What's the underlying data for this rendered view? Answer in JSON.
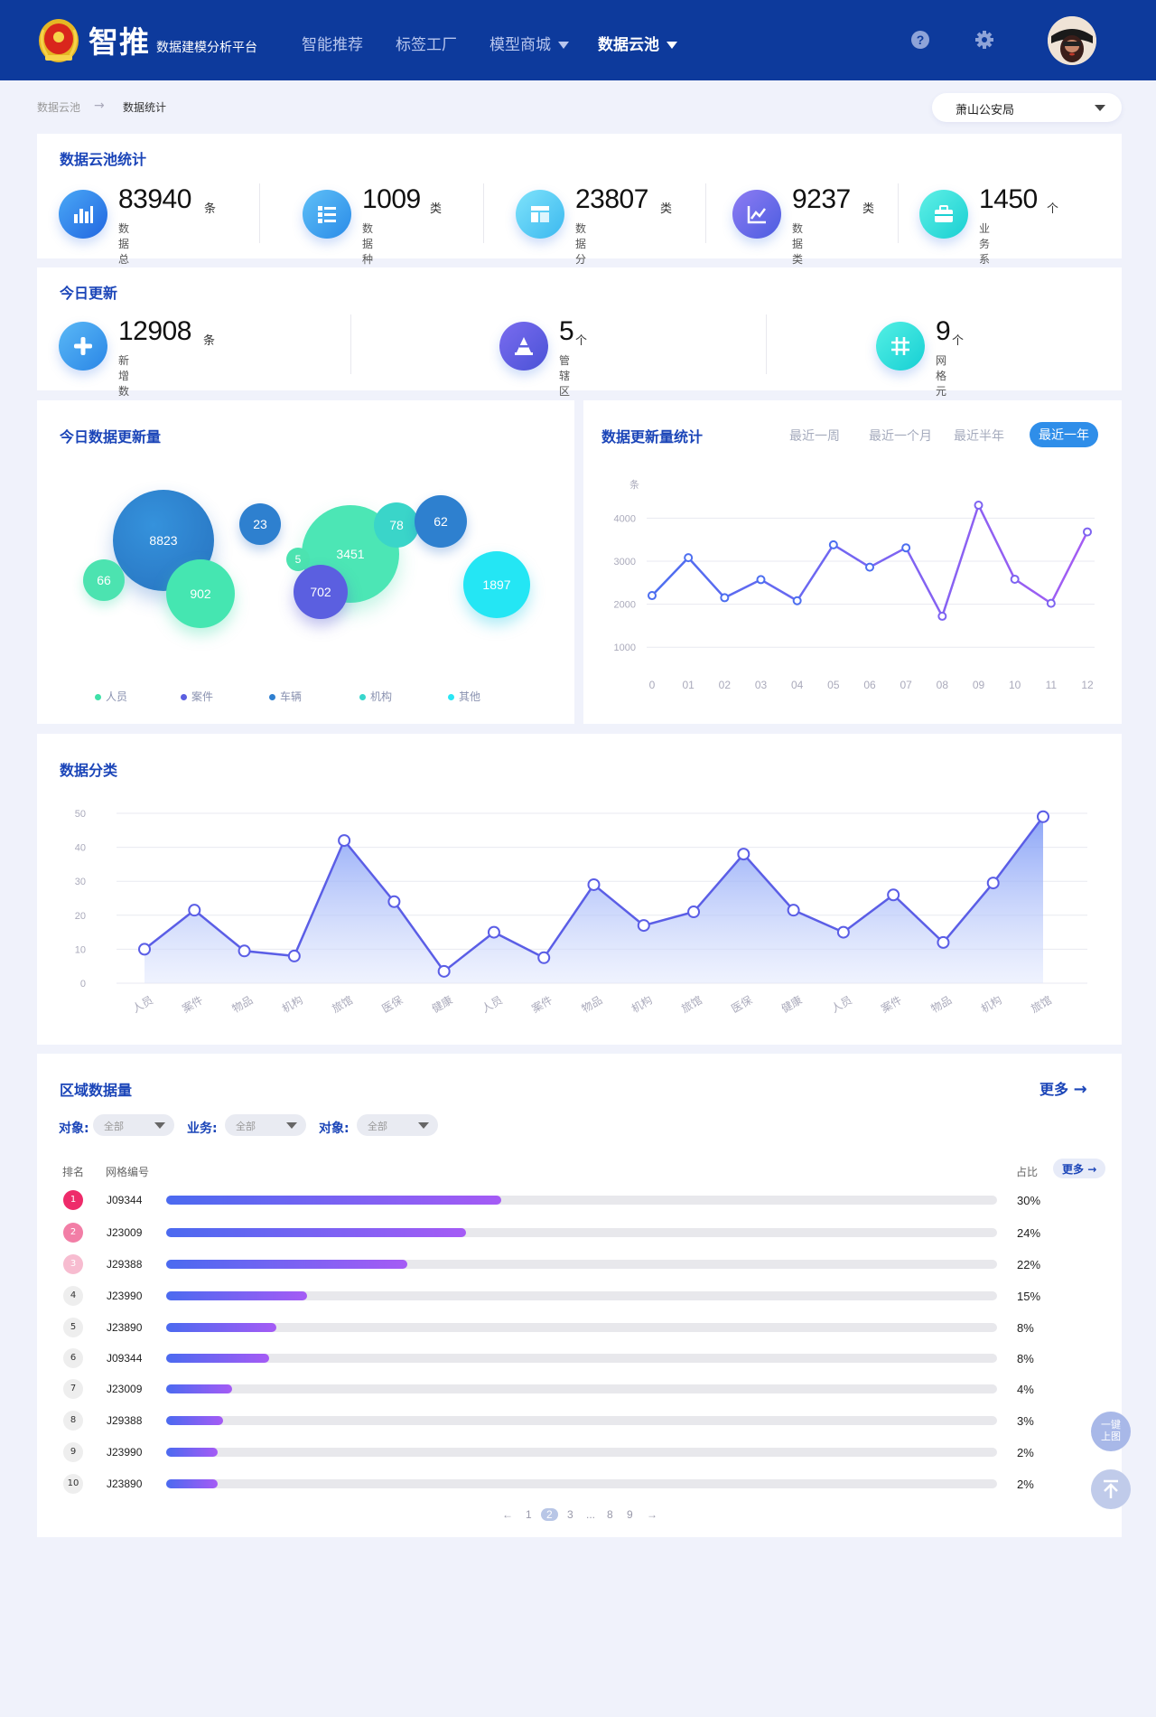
{
  "header": {
    "brand": "智推",
    "brand_sub": "数据建模分析平台",
    "nav": [
      {
        "label": "智能推荐"
      },
      {
        "label": "标签工厂"
      },
      {
        "label": "模型商城"
      },
      {
        "label": "数据云池"
      }
    ]
  },
  "breadcrumb": {
    "root": "数据云池",
    "current": "数据统计"
  },
  "org_select": {
    "value": "萧山公安局"
  },
  "cloud_stats": {
    "title": "数据云池统计",
    "items": [
      {
        "value": "83940",
        "unit": "条",
        "label": "数据总量",
        "icon": "bar-chart-icon",
        "color": "#2f7fea"
      },
      {
        "value": "1009",
        "unit": "类",
        "label": "数据种类",
        "icon": "list-icon",
        "color": "#3a9ef0"
      },
      {
        "value": "23807",
        "unit": "类",
        "label": "数据分类",
        "icon": "table-icon",
        "color": "#5fd2f5"
      },
      {
        "value": "9237",
        "unit": "类",
        "label": "数据类别",
        "icon": "trend-icon",
        "color": "#6a66e8"
      },
      {
        "value": "1450",
        "unit": "个",
        "label": "业务系统",
        "icon": "briefcase-icon",
        "color": "#26d9d9"
      }
    ]
  },
  "today": {
    "title": "今日更新",
    "items": [
      {
        "value": "12908",
        "unit": "条",
        "label": "新增数据量",
        "icon": "plus-icon",
        "color": "#2f9ff0"
      },
      {
        "value": "5",
        "unit": "个",
        "label": "管辖区",
        "icon": "cone-icon",
        "color": "#5a5fe0"
      },
      {
        "value": "9",
        "unit": "个",
        "label": "网格元",
        "icon": "grid-icon",
        "color": "#27dbd9"
      }
    ]
  },
  "bubbles": {
    "title": "今日数据更新量",
    "items": [
      {
        "value": "8823",
        "category": "车辆"
      },
      {
        "value": "23",
        "category": "车辆"
      },
      {
        "value": "66",
        "category": "人员"
      },
      {
        "value": "902",
        "category": "人员"
      },
      {
        "value": "3451",
        "category": "人员"
      },
      {
        "value": "78",
        "category": "机构"
      },
      {
        "value": "62",
        "category": "车辆"
      },
      {
        "value": "5",
        "category": "人员"
      },
      {
        "value": "702",
        "category": "案件"
      },
      {
        "value": "1897",
        "category": "其他"
      }
    ],
    "legend": [
      {
        "label": "人员",
        "color": "#3fe0a8"
      },
      {
        "label": "案件",
        "color": "#5b5fe0"
      },
      {
        "label": "车辆",
        "color": "#2f7fd0"
      },
      {
        "label": "机构",
        "color": "#38d6cc"
      },
      {
        "label": "其他",
        "color": "#2ae6f5"
      }
    ]
  },
  "update_chart": {
    "title": "数据更新量统计",
    "tabs": [
      "最近一周",
      "最近一个月",
      "最近半年",
      "最近一年"
    ],
    "active_tab": 3
  },
  "category_chart": {
    "title": "数据分类"
  },
  "chart_data": [
    {
      "type": "line",
      "ylabel": "条",
      "x": [
        "0",
        "01",
        "02",
        "03",
        "04",
        "05",
        "06",
        "07",
        "08",
        "09",
        "10",
        "11",
        "12"
      ],
      "values": [
        2200,
        3080,
        2150,
        2570,
        2080,
        3380,
        2860,
        3310,
        1720,
        4300,
        2580,
        2020,
        3680
      ],
      "yticks": [
        1000,
        2000,
        3000,
        4000
      ],
      "ylim": [
        500,
        4700
      ],
      "grid": true
    },
    {
      "type": "area",
      "categories": [
        "人员",
        "案件",
        "物品",
        "机构",
        "旅馆",
        "医保",
        "健康",
        "人员",
        "案件",
        "物品",
        "机构",
        "旅馆",
        "医保",
        "健康",
        "人员",
        "案件",
        "物品",
        "机构",
        "旅馆"
      ],
      "values": [
        10,
        21.5,
        9.5,
        8,
        42,
        24,
        3.5,
        15,
        7.5,
        29,
        17,
        21,
        38,
        21.5,
        15,
        26,
        12,
        29.5,
        49
      ],
      "yticks": [
        0,
        10,
        20,
        30,
        40,
        50
      ],
      "ylim": [
        0,
        50
      ],
      "grid": true
    }
  ],
  "region": {
    "title": "区域数据量",
    "more": "更多",
    "filters": [
      {
        "label": "对象:",
        "value": "全部"
      },
      {
        "label": "业务:",
        "value": "全部"
      },
      {
        "label": "对象:",
        "value": "全部"
      }
    ],
    "headers": {
      "rank": "排名",
      "code": "网格编号",
      "pct": "占比",
      "more": "更多"
    },
    "rows": [
      {
        "rank": "1",
        "code": "J09344",
        "pct": "30%",
        "ratio": 0.403
      },
      {
        "rank": "2",
        "code": "J23009",
        "pct": "24%",
        "ratio": 0.361
      },
      {
        "rank": "3",
        "code": "J29388",
        "pct": "22%",
        "ratio": 0.29
      },
      {
        "rank": "4",
        "code": "J23990",
        "pct": "15%",
        "ratio": 0.17
      },
      {
        "rank": "5",
        "code": "J23890",
        "pct": "8%",
        "ratio": 0.133
      },
      {
        "rank": "6",
        "code": "J09344",
        "pct": "8%",
        "ratio": 0.124
      },
      {
        "rank": "7",
        "code": "J23009",
        "pct": "4%",
        "ratio": 0.079
      },
      {
        "rank": "8",
        "code": "J29388",
        "pct": "3%",
        "ratio": 0.069
      },
      {
        "rank": "9",
        "code": "J23990",
        "pct": "2%",
        "ratio": 0.062
      },
      {
        "rank": "10",
        "code": "J23890",
        "pct": "2%",
        "ratio": 0.062
      }
    ],
    "rank_colors": [
      "#ee2b6a",
      "#f27ea6",
      "#f7bcd0",
      "#eeeeee"
    ],
    "pager": [
      "1",
      "2",
      "3",
      "...",
      "8",
      "9"
    ],
    "pager_current": "2"
  },
  "float": {
    "top_text": "一键上图"
  }
}
